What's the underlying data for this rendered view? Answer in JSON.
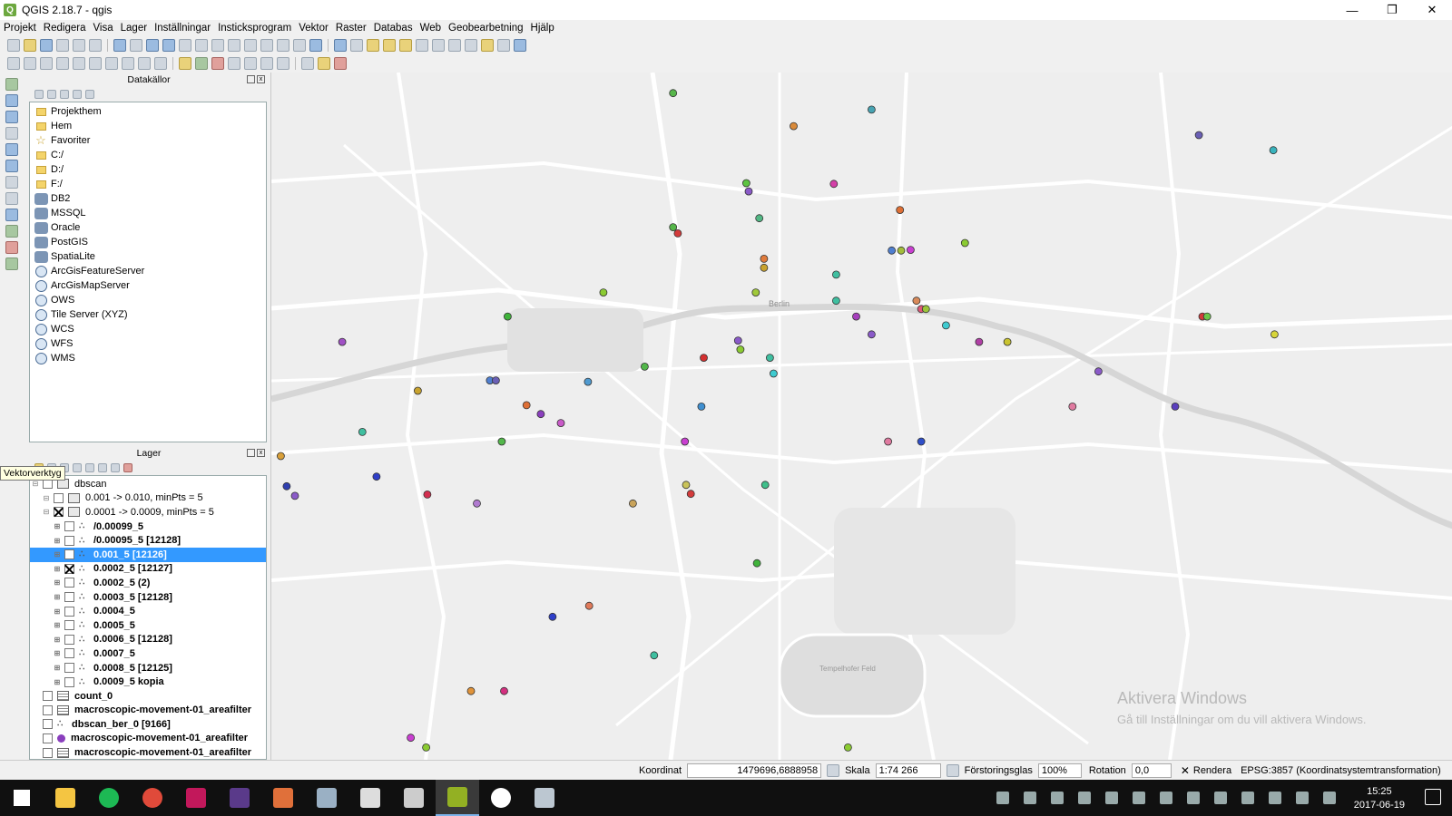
{
  "window": {
    "title": "QGIS 2.18.7 - qgis",
    "minimize": "—",
    "maximize": "❐",
    "close": "✕"
  },
  "menu": [
    "Projekt",
    "Redigera",
    "Visa",
    "Lager",
    "Inställningar",
    "Insticksprogram",
    "Vektor",
    "Raster",
    "Databas",
    "Web",
    "Geobearbetning",
    "Hjälp"
  ],
  "browser": {
    "title": "Datakällor",
    "items": [
      {
        "label": "Projekthem",
        "icon": "folder-icon"
      },
      {
        "label": "Hem",
        "icon": "folder-icon"
      },
      {
        "label": "Favoriter",
        "icon": "star-icon"
      },
      {
        "label": "C:/",
        "icon": "folder-icon"
      },
      {
        "label": "D:/",
        "icon": "folder-icon"
      },
      {
        "label": "F:/",
        "icon": "folder-icon"
      },
      {
        "label": "DB2",
        "icon": "db2-icon"
      },
      {
        "label": "MSSQL",
        "icon": "mssql-icon"
      },
      {
        "label": "Oracle",
        "icon": "oracle-icon"
      },
      {
        "label": "PostGIS",
        "icon": "postgis-icon"
      },
      {
        "label": "SpatiaLite",
        "icon": "spatialite-icon"
      },
      {
        "label": "ArcGisFeatureServer",
        "icon": "globe-icon"
      },
      {
        "label": "ArcGisMapServer",
        "icon": "globe-icon"
      },
      {
        "label": "OWS",
        "icon": "globe-icon"
      },
      {
        "label": "Tile Server (XYZ)",
        "icon": "globe-icon"
      },
      {
        "label": "WCS",
        "icon": "globe-icon"
      },
      {
        "label": "WFS",
        "icon": "globe-icon"
      },
      {
        "label": "WMS",
        "icon": "globe-icon"
      }
    ]
  },
  "layers": {
    "title": "Lager",
    "tooltip": "Vektorverktyg",
    "items": [
      {
        "label": "dbscan",
        "bold": false,
        "indent": 0,
        "kind": "group"
      },
      {
        "label": "0.001 -> 0.010, minPts = 5",
        "bold": false,
        "indent": 1,
        "kind": "group"
      },
      {
        "label": "0.0001 -> 0.0009, minPts = 5",
        "bold": false,
        "indent": 1,
        "kind": "group",
        "checked": true
      },
      {
        "label": "/0.00099_5",
        "bold": true,
        "indent": 2,
        "kind": "point"
      },
      {
        "label": "/0.00095_5 [12128]",
        "bold": true,
        "indent": 2,
        "kind": "point"
      },
      {
        "label": "0.001_5 [12126]",
        "bold": true,
        "indent": 2,
        "kind": "point",
        "selected": true
      },
      {
        "label": "0.0002_5 [12127]",
        "bold": true,
        "indent": 2,
        "kind": "point",
        "checked": true
      },
      {
        "label": "0.0002_5 (2)",
        "bold": true,
        "indent": 2,
        "kind": "point"
      },
      {
        "label": "0.0003_5 [12128]",
        "bold": true,
        "indent": 2,
        "kind": "point"
      },
      {
        "label": "0.0004_5",
        "bold": true,
        "indent": 2,
        "kind": "point"
      },
      {
        "label": "0.0005_5",
        "bold": true,
        "indent": 2,
        "kind": "point"
      },
      {
        "label": "0.0006_5 [12128]",
        "bold": true,
        "indent": 2,
        "kind": "point"
      },
      {
        "label": "0.0007_5",
        "bold": true,
        "indent": 2,
        "kind": "point"
      },
      {
        "label": "0.0008_5 [12125]",
        "bold": true,
        "indent": 2,
        "kind": "point"
      },
      {
        "label": "0.0009_5 kopia",
        "bold": true,
        "indent": 2,
        "kind": "point"
      },
      {
        "label": "count_0",
        "bold": true,
        "indent": 0,
        "kind": "table"
      },
      {
        "label": "macroscopic-movement-01_areafilter",
        "bold": true,
        "indent": 0,
        "kind": "table"
      },
      {
        "label": "dbscan_ber_0 [9166]",
        "bold": true,
        "indent": 0,
        "kind": "point"
      },
      {
        "label": "macroscopic-movement-01_areafilter",
        "bold": true,
        "indent": 0,
        "kind": "dot"
      },
      {
        "label": "macroscopic-movement-01_areafilter",
        "bold": true,
        "indent": 0,
        "kind": "table"
      }
    ]
  },
  "map": {
    "labels": [
      "Berlin",
      "Tempelhofer Feld"
    ],
    "watermark_title": "Aktivera Windows",
    "watermark_sub": "Gå till Inställningar om du vill aktivera Windows.",
    "points": [
      {
        "x": 0.34,
        "y": 0.03,
        "c": "#56b64a"
      },
      {
        "x": 0.508,
        "y": 0.054,
        "c": "#47a3b2"
      },
      {
        "x": 0.442,
        "y": 0.078,
        "c": "#d98a3a"
      },
      {
        "x": 0.785,
        "y": 0.091,
        "c": "#6a5fb5"
      },
      {
        "x": 0.848,
        "y": 0.113,
        "c": "#38b3bd"
      },
      {
        "x": 0.402,
        "y": 0.161,
        "c": "#5dc441"
      },
      {
        "x": 0.404,
        "y": 0.173,
        "c": "#8a5ac8"
      },
      {
        "x": 0.476,
        "y": 0.162,
        "c": "#d43fa8"
      },
      {
        "x": 0.532,
        "y": 0.2,
        "c": "#de6f35"
      },
      {
        "x": 0.413,
        "y": 0.212,
        "c": "#52b784"
      },
      {
        "x": 0.34,
        "y": 0.225,
        "c": "#56b64a"
      },
      {
        "x": 0.344,
        "y": 0.234,
        "c": "#d33b3b"
      },
      {
        "x": 0.587,
        "y": 0.248,
        "c": "#8bcb32"
      },
      {
        "x": 0.525,
        "y": 0.259,
        "c": "#4f7fd0"
      },
      {
        "x": 0.533,
        "y": 0.259,
        "c": "#a3bd3b"
      },
      {
        "x": 0.541,
        "y": 0.258,
        "c": "#c93fd1"
      },
      {
        "x": 0.417,
        "y": 0.271,
        "c": "#e07b3c"
      },
      {
        "x": 0.417,
        "y": 0.284,
        "c": "#c9a32f"
      },
      {
        "x": 0.478,
        "y": 0.294,
        "c": "#3fbfa0"
      },
      {
        "x": 0.281,
        "y": 0.32,
        "c": "#8bcb32"
      },
      {
        "x": 0.41,
        "y": 0.32,
        "c": "#a0c93a"
      },
      {
        "x": 0.2,
        "y": 0.355,
        "c": "#3fb33a"
      },
      {
        "x": 0.478,
        "y": 0.332,
        "c": "#3fbfa0"
      },
      {
        "x": 0.546,
        "y": 0.332,
        "c": "#d98a5a"
      },
      {
        "x": 0.55,
        "y": 0.344,
        "c": "#e05a78"
      },
      {
        "x": 0.554,
        "y": 0.344,
        "c": "#9cc53a"
      },
      {
        "x": 0.495,
        "y": 0.355,
        "c": "#a63fbd"
      },
      {
        "x": 0.571,
        "y": 0.368,
        "c": "#3fcbd0"
      },
      {
        "x": 0.788,
        "y": 0.355,
        "c": "#d33b3b"
      },
      {
        "x": 0.792,
        "y": 0.355,
        "c": "#6cc74a"
      },
      {
        "x": 0.508,
        "y": 0.381,
        "c": "#8a5ac8"
      },
      {
        "x": 0.849,
        "y": 0.381,
        "c": "#d7d53a"
      },
      {
        "x": 0.06,
        "y": 0.392,
        "c": "#a050c5"
      },
      {
        "x": 0.395,
        "y": 0.39,
        "c": "#8a5ac8"
      },
      {
        "x": 0.599,
        "y": 0.392,
        "c": "#b03fa5"
      },
      {
        "x": 0.623,
        "y": 0.392,
        "c": "#c9c32f"
      },
      {
        "x": 0.397,
        "y": 0.403,
        "c": "#8bcb32"
      },
      {
        "x": 0.366,
        "y": 0.415,
        "c": "#d32f2f"
      },
      {
        "x": 0.422,
        "y": 0.415,
        "c": "#3fbfa0"
      },
      {
        "x": 0.316,
        "y": 0.428,
        "c": "#52b74a"
      },
      {
        "x": 0.425,
        "y": 0.438,
        "c": "#3fcbd0"
      },
      {
        "x": 0.7,
        "y": 0.435,
        "c": "#8a5ac8"
      },
      {
        "x": 0.185,
        "y": 0.448,
        "c": "#4f7fd0"
      },
      {
        "x": 0.19,
        "y": 0.448,
        "c": "#6a5fb5"
      },
      {
        "x": 0.268,
        "y": 0.45,
        "c": "#4f9ad0"
      },
      {
        "x": 0.124,
        "y": 0.463,
        "c": "#c9a32f"
      },
      {
        "x": 0.216,
        "y": 0.484,
        "c": "#de6f35"
      },
      {
        "x": 0.228,
        "y": 0.497,
        "c": "#8a3fbd"
      },
      {
        "x": 0.245,
        "y": 0.51,
        "c": "#c95ac8"
      },
      {
        "x": 0.364,
        "y": 0.486,
        "c": "#3f8fd0"
      },
      {
        "x": 0.678,
        "y": 0.486,
        "c": "#e07aa0"
      },
      {
        "x": 0.765,
        "y": 0.486,
        "c": "#5a3fbd"
      },
      {
        "x": 0.077,
        "y": 0.523,
        "c": "#3fbfa0"
      },
      {
        "x": 0.195,
        "y": 0.537,
        "c": "#52b74a"
      },
      {
        "x": 0.35,
        "y": 0.537,
        "c": "#c93fd1"
      },
      {
        "x": 0.522,
        "y": 0.537,
        "c": "#e07aa0"
      },
      {
        "x": 0.55,
        "y": 0.537,
        "c": "#2f4fc9"
      },
      {
        "x": 0.008,
        "y": 0.558,
        "c": "#d9a03a"
      },
      {
        "x": 0.089,
        "y": 0.588,
        "c": "#2f3fc9"
      },
      {
        "x": 0.013,
        "y": 0.602,
        "c": "#2f3fb0"
      },
      {
        "x": 0.02,
        "y": 0.616,
        "c": "#8a5ac8"
      },
      {
        "x": 0.132,
        "y": 0.614,
        "c": "#d32f4f"
      },
      {
        "x": 0.174,
        "y": 0.627,
        "c": "#b07ad0"
      },
      {
        "x": 0.351,
        "y": 0.6,
        "c": "#c9c35a"
      },
      {
        "x": 0.355,
        "y": 0.613,
        "c": "#d33b3b"
      },
      {
        "x": 0.418,
        "y": 0.6,
        "c": "#3fbf8a"
      },
      {
        "x": 0.306,
        "y": 0.627,
        "c": "#c9a35a"
      },
      {
        "x": 0.411,
        "y": 0.714,
        "c": "#3fb33a"
      },
      {
        "x": 0.269,
        "y": 0.776,
        "c": "#e07a5a"
      },
      {
        "x": 0.238,
        "y": 0.792,
        "c": "#2f3fc9"
      },
      {
        "x": 0.324,
        "y": 0.848,
        "c": "#3fbfa0"
      },
      {
        "x": 0.169,
        "y": 0.9,
        "c": "#e0933a"
      },
      {
        "x": 0.197,
        "y": 0.9,
        "c": "#d32f7f"
      },
      {
        "x": 0.118,
        "y": 0.968,
        "c": "#c93fd1"
      },
      {
        "x": 0.131,
        "y": 0.982,
        "c": "#8bcb32"
      },
      {
        "x": 0.488,
        "y": 0.982,
        "c": "#8bcb32"
      }
    ]
  },
  "status": {
    "coord_label": "Koordinat",
    "coord_value": "1479696,6888958",
    "scale_label": "Skala",
    "scale_value": "1:74 266",
    "magnifier_label": "Förstoringsglas",
    "magnifier_value": "100%",
    "rotation_label": "Rotation",
    "rotation_value": "0,0",
    "render_label": "Rendera",
    "crs": "EPSG:3857 (Koordinatsystemtransformation)"
  },
  "taskbar": {
    "time": "15:25",
    "date": "2017-06-19",
    "apps": [
      {
        "name": "windows-start-icon",
        "color": "#ffffff"
      },
      {
        "name": "file-explorer-icon",
        "color": "#f4c542"
      },
      {
        "name": "spotify-icon",
        "color": "#1db954"
      },
      {
        "name": "chrome-icon",
        "color": "#e04a3a"
      },
      {
        "name": "intellij-icon",
        "color": "#c2185b"
      },
      {
        "name": "texstudio-icon",
        "color": "#5a3a8a"
      },
      {
        "name": "git-icon",
        "color": "#e0703a"
      },
      {
        "name": "inkscape-icon",
        "color": "#9ab0c4"
      },
      {
        "name": "photos-icon",
        "color": "#dddddd"
      },
      {
        "name": "cloud-app-icon",
        "color": "#cccccc"
      },
      {
        "name": "qgis-icon",
        "color": "#93b023"
      },
      {
        "name": "weather-icon",
        "color": "#ffffff"
      },
      {
        "name": "window-app-icon",
        "color": "#bcc7d1"
      }
    ]
  }
}
